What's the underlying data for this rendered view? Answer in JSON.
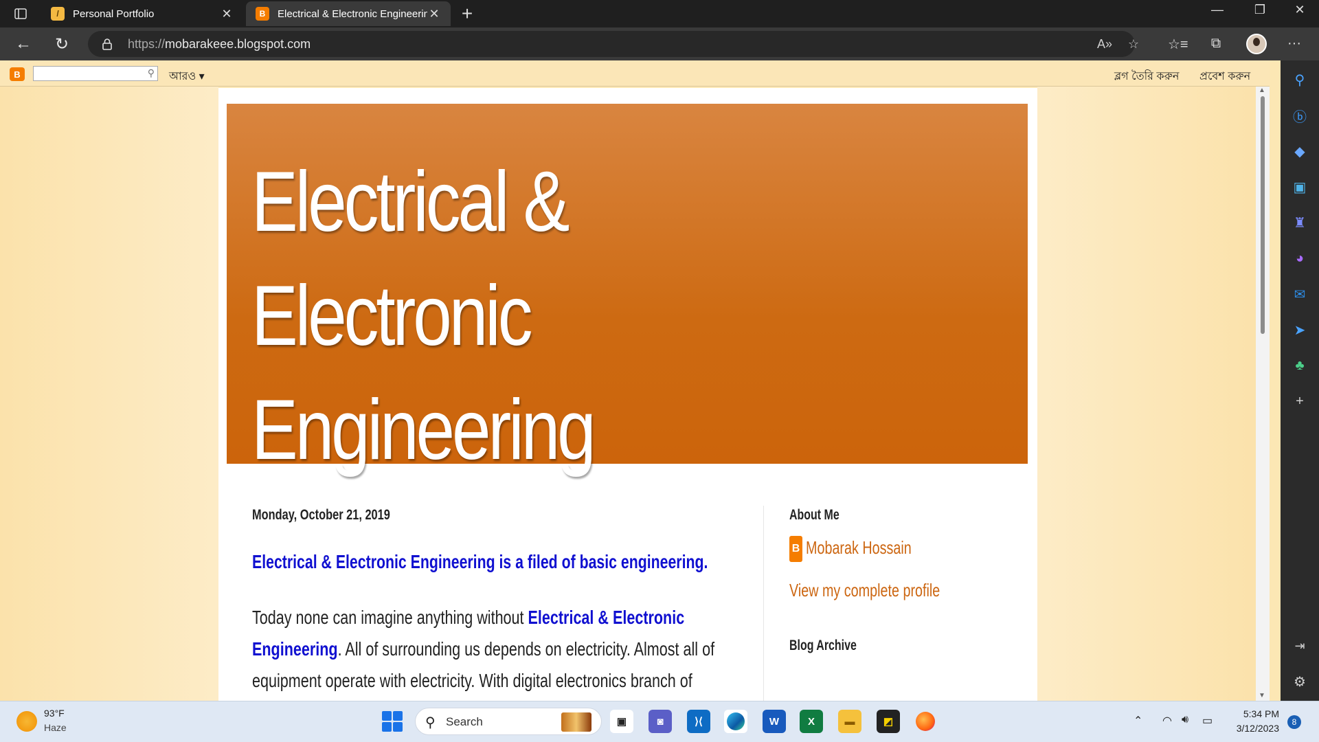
{
  "browser": {
    "tabs": [
      {
        "title": "Personal Portfolio",
        "favicon": "portfolio-icon",
        "active": false
      },
      {
        "title": "Electrical & Electronic Engineerin",
        "favicon": "blogger-icon",
        "active": true
      }
    ],
    "address": {
      "protocol": "https://",
      "host": "mobarakeee.blogspot.com"
    }
  },
  "blogger_nav": {
    "logo": "B",
    "more_label": "আরও ▾",
    "create_blog_label": "ব্লগ তৈরি করুন",
    "sign_in_label": "প্রবেশ করুন"
  },
  "blog": {
    "title": "Electrical & Electronic Engineering",
    "post": {
      "date": "Monday, October 21, 2019",
      "title": "Electrical & Electronic Engineering is a filed of basic engineering.",
      "body_pre": "Today none can imagine anything without ",
      "body_highlight": "Electrical & Electronic Engineering",
      "body_post": ". All of surrounding us depends on electricity. Almost all of equipment operate with electricity. With digital electronics branch of electronic engineering different consumer products now in the market. With these type of"
    },
    "sidebar": {
      "about_heading": "About Me",
      "profile_name": "Mobarak Hossain",
      "profile_link": "View my complete profile",
      "archive_heading": "Blog Archive"
    }
  },
  "taskbar": {
    "weather_temp": "93°F",
    "weather_desc": "Haze",
    "search_label": "Search",
    "time": "5:34 PM",
    "date": "3/12/2023",
    "notification_count": "8"
  },
  "colors": {
    "header_orange": "#cc640b",
    "link_blue": "#1010d0",
    "profile_orange": "#cc6611",
    "page_background": "#fce7b4"
  }
}
